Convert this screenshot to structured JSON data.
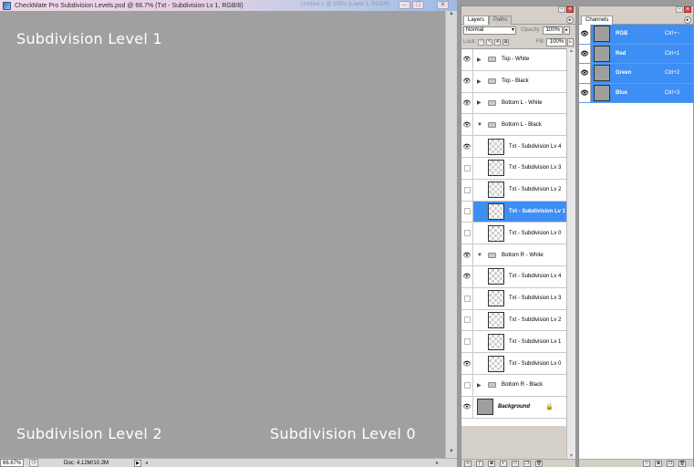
{
  "document": {
    "title": "CheckMate Pro Subdivision Levels.psd @ 66.7% (Txt - Subdivision Lv 1, RGB/8)",
    "title_extra": "Untitled-1 @ 100% (Layer 1, RGB/8)",
    "canvas_labels": {
      "top": "Subdivision Level 1",
      "bottom_left": "Subdivision Level 2",
      "bottom_right": "Subdivision Level 0"
    },
    "canvas_color": "#a0a0a0",
    "text_color": "#ffffff"
  },
  "status_bar": {
    "zoom": "66.67%",
    "doc_size": "Doc: 4.12M/10.2M"
  },
  "layers_panel": {
    "tabs": [
      "Layers",
      "Paths"
    ],
    "blend_mode": "Normal",
    "opacity_label": "Opacity:",
    "opacity_value": "100%",
    "lock_label": "Lock:",
    "fill_label": "Fill:",
    "fill_value": "100%",
    "layers": [
      {
        "name": "Top - White",
        "type": "group",
        "expanded": false,
        "visible": true,
        "selected": false
      },
      {
        "name": "Top - Black",
        "type": "group",
        "expanded": false,
        "visible": true,
        "selected": false
      },
      {
        "name": "Bottom L - White",
        "type": "group",
        "expanded": false,
        "visible": true,
        "selected": false
      },
      {
        "name": "Bottom L - Black",
        "type": "group",
        "expanded": true,
        "visible": true,
        "selected": false
      },
      {
        "name": "Txt - Subdivision Lv 4",
        "type": "layer",
        "visible": true,
        "selected": false
      },
      {
        "name": "Txt - Subdivision Lv 3",
        "type": "layer",
        "visible": false,
        "selected": false
      },
      {
        "name": "Txt - Subdivision Lv 2",
        "type": "layer",
        "visible": false,
        "selected": false
      },
      {
        "name": "Txt - Subdivision Lv 1",
        "type": "layer",
        "visible": false,
        "selected": true
      },
      {
        "name": "Txt - Subdivision Lv 0",
        "type": "layer",
        "visible": false,
        "selected": false
      },
      {
        "name": "Bottom R - White",
        "type": "group",
        "expanded": true,
        "visible": true,
        "selected": false
      },
      {
        "name": "Txt - Subdivision Lv 4",
        "type": "layer",
        "visible": true,
        "selected": false
      },
      {
        "name": "Txt - Subdivision Lv 3",
        "type": "layer",
        "visible": false,
        "selected": false
      },
      {
        "name": "Txt - Subdivision Lv 2",
        "type": "layer",
        "visible": false,
        "selected": false
      },
      {
        "name": "Txt - Subdivision Lv 1",
        "type": "layer",
        "visible": false,
        "selected": false
      },
      {
        "name": "Txt - Subdivision Lv 0",
        "type": "layer",
        "visible": true,
        "selected": false
      },
      {
        "name": "Bottom R - Black",
        "type": "group",
        "expanded": false,
        "visible": false,
        "selected": false
      },
      {
        "name": "Background",
        "type": "background",
        "visible": true,
        "selected": false,
        "locked": true
      }
    ],
    "selection_color": "#3d8ff5"
  },
  "channels_panel": {
    "tab": "Channels",
    "channels": [
      {
        "name": "RGB",
        "shortcut": "Ctrl+~"
      },
      {
        "name": "Red",
        "shortcut": "Ctrl+1"
      },
      {
        "name": "Green",
        "shortcut": "Ctrl+2"
      },
      {
        "name": "Blue",
        "shortcut": "Ctrl+3"
      }
    ]
  },
  "icons": {
    "visibility": "eye-icon",
    "group": "folder-icon",
    "lock": "lock-icon"
  }
}
